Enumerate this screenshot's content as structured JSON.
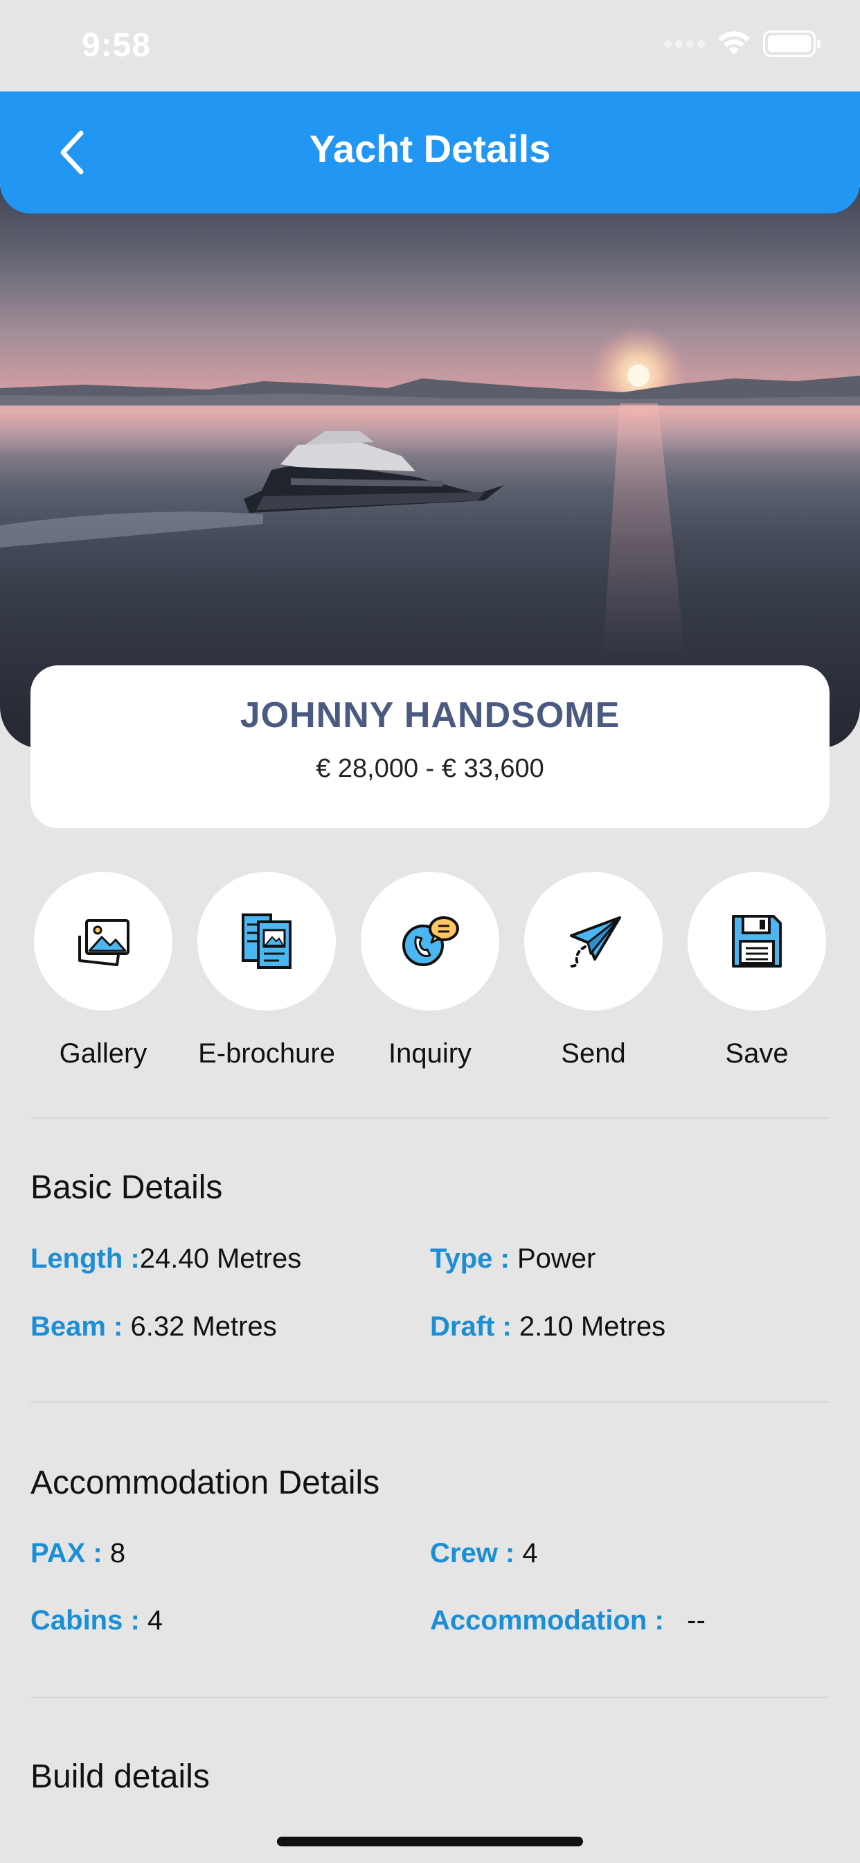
{
  "status_bar": {
    "time": "9:58"
  },
  "header": {
    "title": "Yacht Details"
  },
  "yacht": {
    "name": "JOHNNY HANDSOME",
    "price": "€ 28,000 - € 33,600"
  },
  "actions": [
    {
      "label": "Gallery",
      "icon": "gallery-icon"
    },
    {
      "label": "E-brochure",
      "icon": "brochure-icon"
    },
    {
      "label": "Inquiry",
      "icon": "inquiry-icon"
    },
    {
      "label": "Send",
      "icon": "send-icon"
    },
    {
      "label": "Save",
      "icon": "save-icon"
    }
  ],
  "basic_details": {
    "title": "Basic Details",
    "length": {
      "label": "Length :",
      "value": "24.40 Metres"
    },
    "type": {
      "label": "Type :",
      "value": "Power"
    },
    "beam": {
      "label": "Beam :",
      "value": "6.32 Metres"
    },
    "draft": {
      "label": "Draft :",
      "value": "2.10 Metres"
    }
  },
  "accommodation_details": {
    "title": "Accommodation Details",
    "pax": {
      "label": "PAX :",
      "value": "8"
    },
    "crew": {
      "label": "Crew :",
      "value": "4"
    },
    "cabins": {
      "label": "Cabins :",
      "value": "4"
    },
    "accommodation": {
      "label": "Accommodation :",
      "value": "--"
    }
  },
  "build_details": {
    "title": "Build details"
  },
  "colors": {
    "header": "#2196f3",
    "label_blue": "#1b8fd6",
    "name": "#4a5a80",
    "background": "#e5e5e5"
  }
}
